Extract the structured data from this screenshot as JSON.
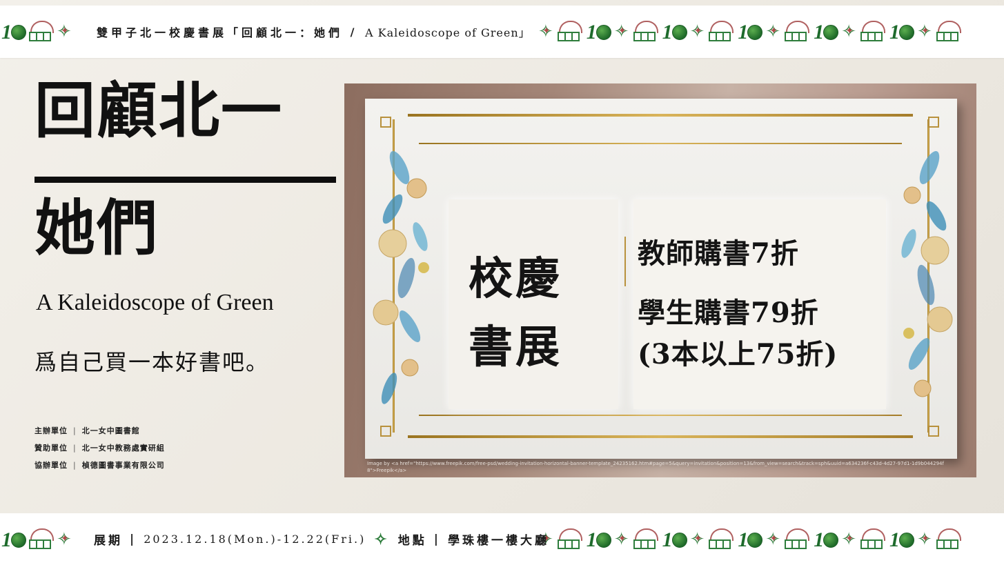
{
  "top_banner": {
    "text_zh": "雙甲子北一校慶書展「回顧北一：她們",
    "slash": " / ",
    "text_en": "A Kaleidoscope of Green」"
  },
  "title": {
    "main": "回顧北一",
    "sub": "她們",
    "english": "A Kaleidoscope of Green",
    "slogan": "爲自己買一本好書吧。"
  },
  "organizers": [
    {
      "role": "主辦單位",
      "name": "北一女中圖書館"
    },
    {
      "role": "贊助單位",
      "name": "北一女中教務處實研組"
    },
    {
      "role": "協辦單位",
      "name": "楨德圖書事業有限公司"
    }
  ],
  "organizer_sep": "|",
  "poster": {
    "fair_line1": "校慶",
    "fair_line2": "書展",
    "teacher_price": "教師購書7折",
    "student_price": "學生購書79折",
    "bulk_price": "(3本以上75折)",
    "credit": "Image by <a href=\"https://www.freepik.com/free-psd/wedding-invitation-horizontal-banner-template_24235162.htm#page=5&query=invitation&position=13&from_view=search&track=sph&uuid=a634236f-c43d-4d27-97d1-1d9b044294f8\">Freepik</a>"
  },
  "bottom_banner": {
    "period_label": "展期",
    "bar": "|",
    "period_value": "2023.12.18(Mon.)-12.22(Fri.)",
    "location_label": "地點",
    "location_value": "學珠樓一樓大廳"
  },
  "colors": {
    "green": "#2e7d3c",
    "red": "#b04848",
    "gold": "#b8913c"
  },
  "icons": [
    "anniversary-120-logo-icon",
    "school-gate-icon",
    "star-ornament-icon"
  ]
}
